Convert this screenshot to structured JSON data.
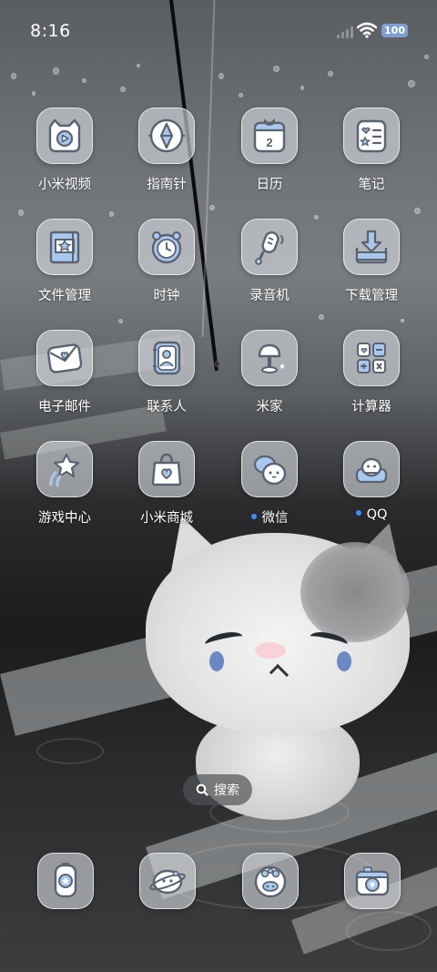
{
  "status_bar": {
    "time": "8:16",
    "battery": "100",
    "signal_icon": "cellular-signal-icon",
    "wifi_icon": "wifi-icon"
  },
  "apps": [
    {
      "label": "小米视频",
      "icon": "video-icon"
    },
    {
      "label": "指南针",
      "icon": "compass-icon"
    },
    {
      "label": "日历",
      "icon": "calendar-icon",
      "badge": "2"
    },
    {
      "label": "笔记",
      "icon": "notes-icon"
    },
    {
      "label": "文件管理",
      "icon": "file-manager-icon"
    },
    {
      "label": "时钟",
      "icon": "clock-icon"
    },
    {
      "label": "录音机",
      "icon": "recorder-icon"
    },
    {
      "label": "下载管理",
      "icon": "download-icon"
    },
    {
      "label": "电子邮件",
      "icon": "email-icon"
    },
    {
      "label": "联系人",
      "icon": "contacts-icon"
    },
    {
      "label": "米家",
      "icon": "mijia-lamp-icon"
    },
    {
      "label": "计算器",
      "icon": "calculator-icon"
    },
    {
      "label": "游戏中心",
      "icon": "game-center-icon"
    },
    {
      "label": "小米商城",
      "icon": "shopping-bag-icon"
    },
    {
      "label": "微信",
      "icon": "wechat-icon",
      "new_indicator": true
    },
    {
      "label": "QQ",
      "icon": "qq-icon",
      "new_indicator": true
    }
  ],
  "search": {
    "label": "搜索",
    "icon": "search-icon"
  },
  "dock": [
    {
      "icon": "phone-icon"
    },
    {
      "icon": "messages-icon"
    },
    {
      "icon": "browser-icon"
    },
    {
      "icon": "camera-icon"
    }
  ],
  "colors": {
    "accent_blue": "#3d8cff",
    "icon_blue": "#a9c8ee",
    "icon_outline": "#5b6270",
    "battery": "#7d9fcf"
  }
}
